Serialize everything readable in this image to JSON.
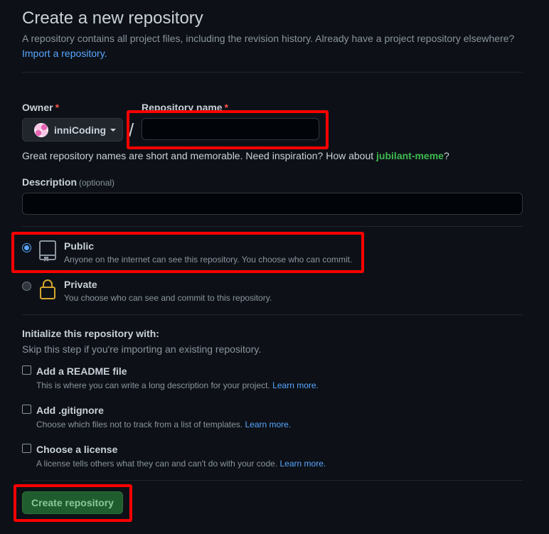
{
  "header": {
    "title": "Create a new repository",
    "subtitle": "A repository contains all project files, including the revision history. Already have a project repository elsewhere?",
    "import_link": "Import a repository."
  },
  "owner": {
    "label": "Owner",
    "required_mark": "*",
    "value": "inniCoding"
  },
  "repo_name": {
    "label": "Repository name",
    "required_mark": "*",
    "value": "",
    "separator": "/"
  },
  "hint": {
    "text": "Great repository names are short and memorable. Need inspiration? How about ",
    "suggestion": "jubilant-meme",
    "end": "?"
  },
  "description": {
    "label": "Description",
    "optional": "(optional)",
    "value": ""
  },
  "visibility": {
    "selected": "public",
    "public": {
      "title": "Public",
      "desc": "Anyone on the internet can see this repository. You choose who can commit."
    },
    "private": {
      "title": "Private",
      "desc": "You choose who can see and commit to this repository."
    }
  },
  "initialize": {
    "title": "Initialize this repository with:",
    "subtitle": "Skip this step if you're importing an existing repository.",
    "options": [
      {
        "title": "Add a README file",
        "desc": "This is where you can write a long description for your project.",
        "link": "Learn more.",
        "checked": false
      },
      {
        "title": "Add .gitignore",
        "desc": "Choose which files not to track from a list of templates.",
        "link": "Learn more.",
        "checked": false
      },
      {
        "title": "Choose a license",
        "desc": "A license tells others what they can and can't do with your code.",
        "link": "Learn more.",
        "checked": false
      }
    ]
  },
  "submit": {
    "label": "Create repository"
  },
  "colors": {
    "background": "#0d1117",
    "accent_link": "#58a6ff",
    "highlight": "#ff0000",
    "create_button": "#1f5c2e",
    "suggestion": "#3fb950"
  }
}
